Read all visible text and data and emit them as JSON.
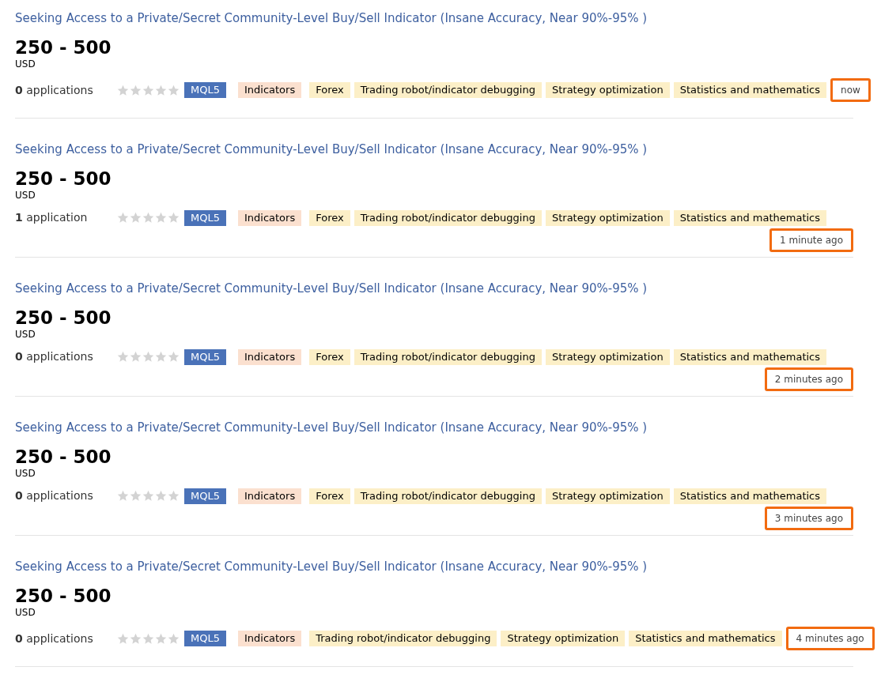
{
  "listings": [
    {
      "title": "Seeking Access to a Private/Secret Community-Level Buy/Sell Indicator (Insane Accuracy, Near 90%-95% )",
      "price": "250 - 500",
      "currency": "USD",
      "applications_count": "0",
      "applications_label": "applications",
      "stars": 0,
      "tags": [
        {
          "kind": "platform",
          "label": "MQL5"
        },
        {
          "kind": "category",
          "label": "Indicators"
        },
        {
          "kind": "skill",
          "label": "Forex"
        },
        {
          "kind": "skill",
          "label": "Trading robot/indicator debugging"
        },
        {
          "kind": "skill",
          "label": "Strategy optimization"
        },
        {
          "kind": "skill",
          "label": "Statistics and mathematics"
        }
      ],
      "time": "now",
      "kind": "inline",
      "highlighted": true
    },
    {
      "title": "Seeking Access to a Private/Secret Community-Level Buy/Sell Indicator (Insane Accuracy, Near 90%-95% )",
      "price": "250 - 500",
      "currency": "USD",
      "applications_count": "1",
      "applications_label": "application",
      "stars": 0,
      "tags": [
        {
          "kind": "platform",
          "label": "MQL5"
        },
        {
          "kind": "category",
          "label": "Indicators"
        },
        {
          "kind": "skill",
          "label": "Forex"
        },
        {
          "kind": "skill",
          "label": "Trading robot/indicator debugging"
        },
        {
          "kind": "skill",
          "label": "Strategy optimization"
        },
        {
          "kind": "skill",
          "label": "Statistics and mathematics"
        }
      ],
      "time": "1 minute ago",
      "kind": "below",
      "highlighted": true
    },
    {
      "title": "Seeking Access to a Private/Secret Community-Level Buy/Sell Indicator (Insane Accuracy, Near 90%-95% )",
      "price": "250 - 500",
      "currency": "USD",
      "applications_count": "0",
      "applications_label": "applications",
      "stars": 0,
      "tags": [
        {
          "kind": "platform",
          "label": "MQL5"
        },
        {
          "kind": "category",
          "label": "Indicators"
        },
        {
          "kind": "skill",
          "label": "Forex"
        },
        {
          "kind": "skill",
          "label": "Trading robot/indicator debugging"
        },
        {
          "kind": "skill",
          "label": "Strategy optimization"
        },
        {
          "kind": "skill",
          "label": "Statistics and mathematics"
        }
      ],
      "time": "2 minutes ago",
      "kind": "below",
      "highlighted": true
    },
    {
      "title": "Seeking Access to a Private/Secret Community-Level Buy/Sell Indicator (Insane Accuracy, Near 90%-95% )",
      "price": "250 - 500",
      "currency": "USD",
      "applications_count": "0",
      "applications_label": "applications",
      "stars": 0,
      "tags": [
        {
          "kind": "platform",
          "label": "MQL5"
        },
        {
          "kind": "category",
          "label": "Indicators"
        },
        {
          "kind": "skill",
          "label": "Forex"
        },
        {
          "kind": "skill",
          "label": "Trading robot/indicator debugging"
        },
        {
          "kind": "skill",
          "label": "Strategy optimization"
        },
        {
          "kind": "skill",
          "label": "Statistics and mathematics"
        }
      ],
      "time": "3 minutes ago",
      "kind": "below",
      "highlighted": true
    },
    {
      "title": "Seeking Access to a Private/Secret Community-Level Buy/Sell Indicator (Insane Accuracy, Near 90%-95% )",
      "price": "250 - 500",
      "currency": "USD",
      "applications_count": "0",
      "applications_label": "applications",
      "stars": 0,
      "tags": [
        {
          "kind": "platform",
          "label": "MQL5"
        },
        {
          "kind": "category",
          "label": "Indicators"
        },
        {
          "kind": "skill",
          "label": "Trading robot/indicator debugging"
        },
        {
          "kind": "skill",
          "label": "Strategy optimization"
        },
        {
          "kind": "skill",
          "label": "Statistics and mathematics"
        }
      ],
      "time": "4 minutes ago",
      "kind": "inline",
      "highlighted": true
    }
  ]
}
